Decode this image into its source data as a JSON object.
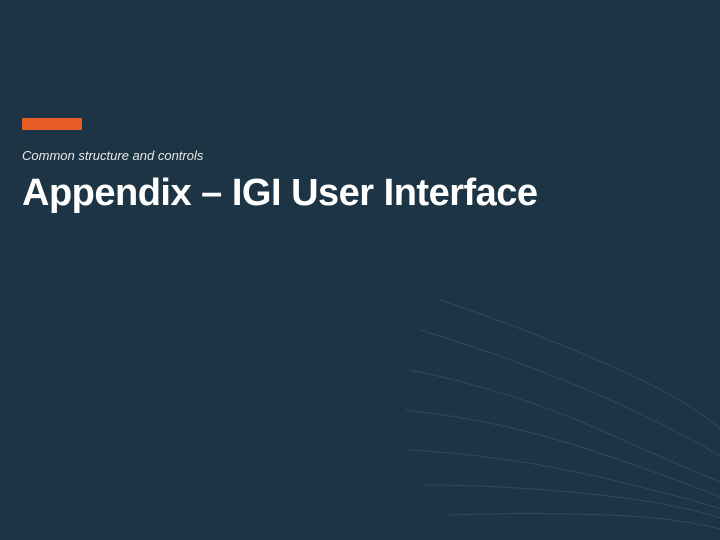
{
  "slide": {
    "subtitle": "Common structure and controls",
    "title": "Appendix – IGI User Interface"
  },
  "colors": {
    "background": "#1c3444",
    "accent": "#e85c25",
    "text_primary": "#ffffff",
    "text_secondary": "#e8e8e8",
    "decorative_stroke": "#2a5560"
  }
}
